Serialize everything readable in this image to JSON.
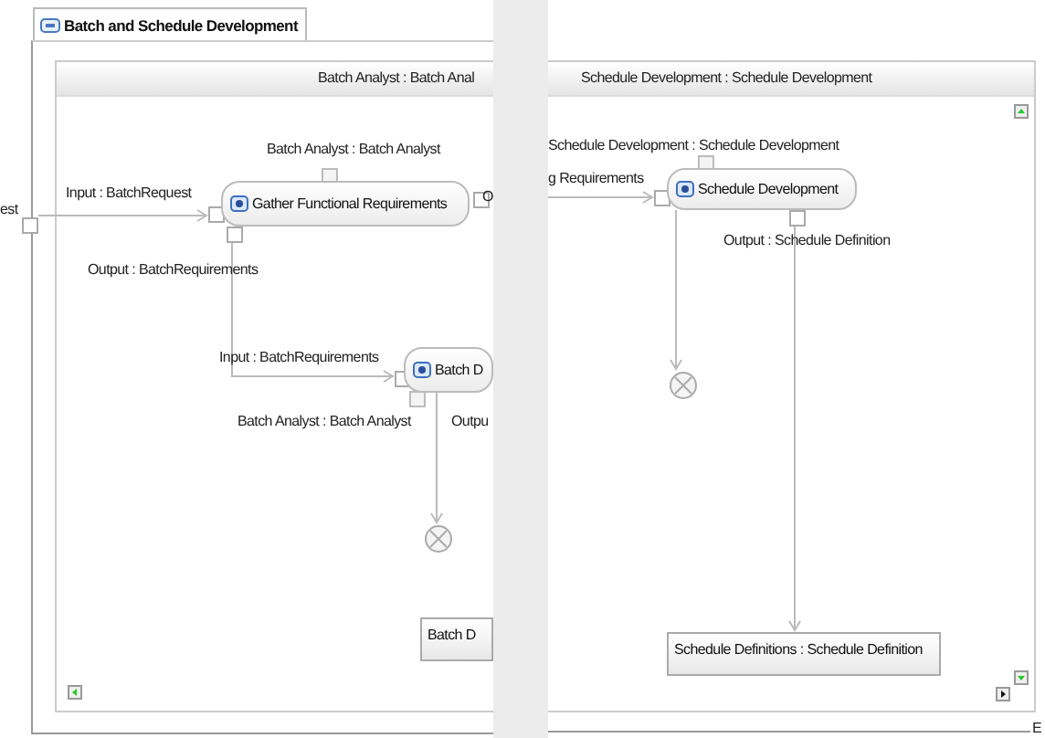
{
  "editor_tab": {
    "title": "Batch and Schedule Development"
  },
  "left_pane": {
    "header": "Batch Analyst : Batch Anal",
    "nodes": [
      {
        "kind": "action",
        "label": "Gather Functional Requirements"
      },
      {
        "kind": "action",
        "label": "Batch D"
      },
      {
        "kind": "final"
      },
      {
        "kind": "object",
        "label": "Batch D"
      }
    ],
    "labels": [
      "est",
      "Input : BatchRequest",
      "Batch Analyst : Batch Analyst",
      "O",
      "Output : BatchRequirements",
      "Input : BatchRequirements",
      "Batch Analyst : Batch Analyst",
      "Outpu"
    ]
  },
  "right_pane": {
    "header": "Schedule Development : Schedule Development",
    "nodes": [
      {
        "kind": "action",
        "label": "Schedule Development"
      },
      {
        "kind": "final"
      },
      {
        "kind": "object",
        "label": "Schedule Definitions : Schedule Definition"
      }
    ],
    "labels": [
      "Schedule Development : Schedule Development",
      "g Requirements",
      "Output : Schedule Definition",
      "E"
    ]
  }
}
